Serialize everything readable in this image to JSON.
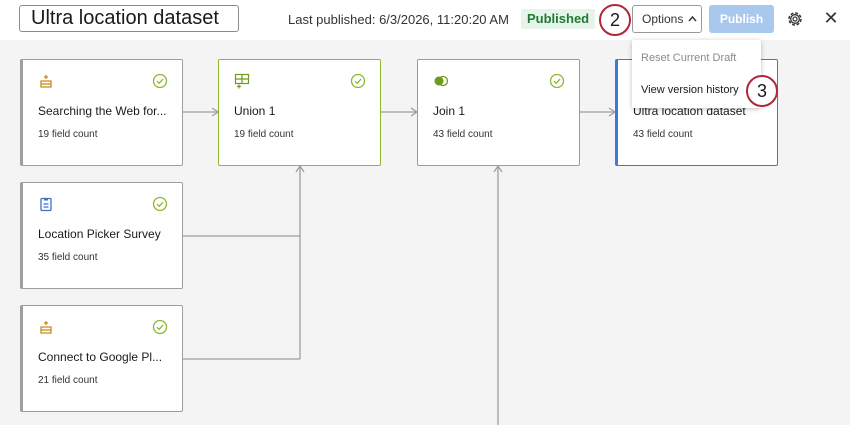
{
  "header": {
    "title": "Ultra location dataset",
    "last_published": "Last published: 6/3/2026, 11:20:20 AM",
    "status_badge": "Published",
    "options_label": "Options",
    "publish_label": "Publish",
    "close_glyph": "✕"
  },
  "markers": {
    "step_options": "2",
    "step_history": "3"
  },
  "dropdown": {
    "items": [
      {
        "label": "Reset Current Draft",
        "enabled": false
      },
      {
        "label": "View version history",
        "enabled": true
      }
    ]
  },
  "nodes": [
    {
      "name": "Searching the Web for...",
      "field_count": "19 field count",
      "icon": "source-icon"
    },
    {
      "name": "Location Picker Survey",
      "field_count": "35 field count",
      "icon": "survey-icon"
    },
    {
      "name": "Connect to Google Pl...",
      "field_count": "21 field count",
      "icon": "source-icon"
    },
    {
      "name": "Union 1",
      "field_count": "19 field count",
      "icon": "union-icon"
    },
    {
      "name": "Join 1",
      "field_count": "43 field count",
      "icon": "join-icon"
    },
    {
      "name": "Ultra location dataset",
      "field_count": "43 field count",
      "icon": "output-icon"
    }
  ],
  "colors": {
    "valid": "#8db72e",
    "selected": "#4078d6",
    "published": "#1e7b34",
    "publish_disabled": "#a9c8ee",
    "marker": "#b0273a"
  }
}
